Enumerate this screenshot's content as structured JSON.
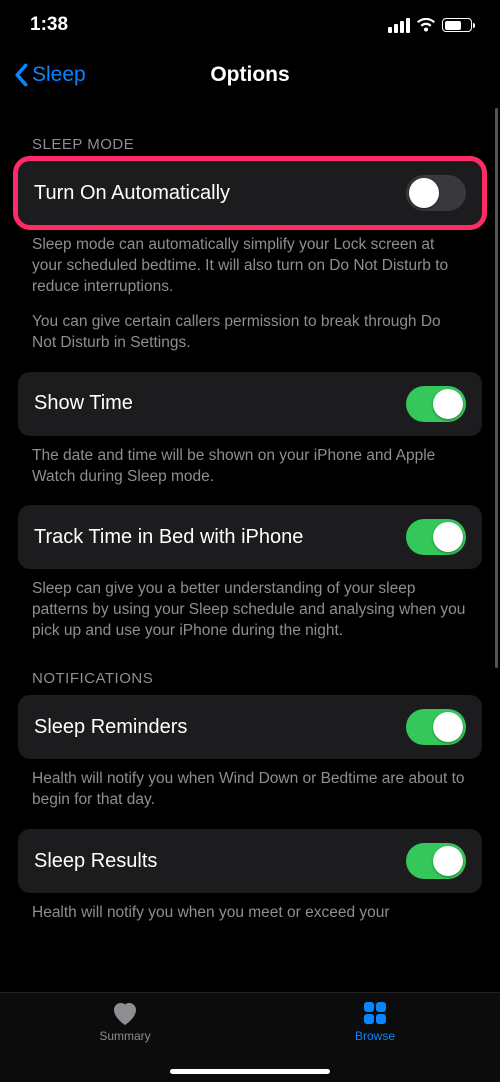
{
  "status": {
    "time": "1:38"
  },
  "nav": {
    "back_label": "Sleep",
    "title": "Options"
  },
  "sections": {
    "sleep_mode": {
      "header": "SLEEP MODE",
      "auto": {
        "label": "Turn On Automatically",
        "on": false
      },
      "footer1": "Sleep mode can automatically simplify your Lock screen at your scheduled bedtime. It will also turn on Do Not Disturb to reduce interruptions.",
      "footer2": "You can give certain callers permission to break through Do Not Disturb in Settings.",
      "show_time": {
        "label": "Show Time",
        "on": true
      },
      "show_time_footer": "The date and time will be shown on your iPhone and Apple Watch during Sleep mode.",
      "track": {
        "label": "Track Time in Bed with iPhone",
        "on": true
      },
      "track_footer": "Sleep can give you a better understanding of your sleep patterns by using your Sleep schedule and analysing when you pick up and use your iPhone during the night."
    },
    "notifications": {
      "header": "NOTIFICATIONS",
      "reminders": {
        "label": "Sleep Reminders",
        "on": true
      },
      "reminders_footer": "Health will notify you when Wind Down or Bedtime are about to begin for that day.",
      "results": {
        "label": "Sleep Results",
        "on": true
      },
      "results_footer": "Health will notify you when you meet or exceed your"
    }
  },
  "tabs": {
    "summary": "Summary",
    "browse": "Browse"
  }
}
